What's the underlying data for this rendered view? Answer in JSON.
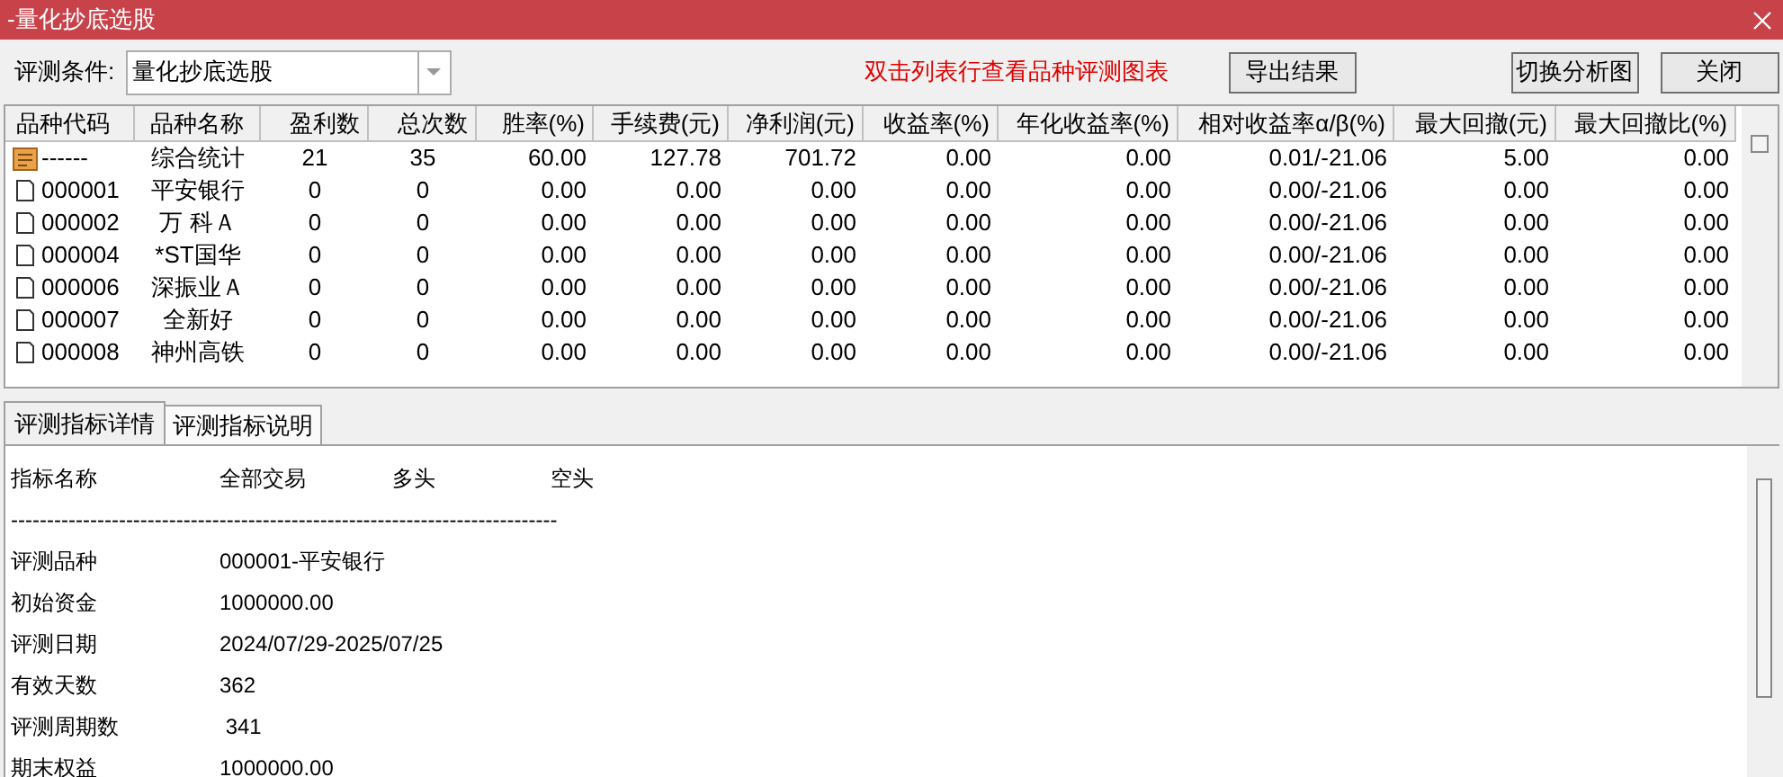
{
  "window": {
    "title": "-量化抄底选股"
  },
  "toolbar": {
    "condition_label": "评测条件:",
    "condition_value": "量化抄底选股",
    "hint": "双击列表行查看品种评测图表",
    "buttons": [
      "导出结果",
      "切换分析图",
      "关闭"
    ]
  },
  "table": {
    "columns": [
      "品种代码",
      "品种名称",
      "盈利数",
      "总次数",
      "胜率(%)",
      "手续费(元)",
      "净利润(元)",
      "收益率(%)",
      "年化收益率(%)",
      "相对收益率α/β(%)",
      "最大回撤(元)",
      "最大回撤比(%)"
    ],
    "rows": [
      {
        "kind": "summary",
        "cells": [
          "------",
          "综合统计",
          "21",
          "35",
          "60.00",
          "127.78",
          "701.72",
          "0.00",
          "0.00",
          "0.01/-21.06",
          "5.00",
          "0.00"
        ]
      },
      {
        "kind": "stock",
        "cells": [
          "000001",
          "平安银行",
          "0",
          "0",
          "0.00",
          "0.00",
          "0.00",
          "0.00",
          "0.00",
          "0.00/-21.06",
          "0.00",
          "0.00"
        ]
      },
      {
        "kind": "stock",
        "cells": [
          "000002",
          "万 科Ａ",
          "0",
          "0",
          "0.00",
          "0.00",
          "0.00",
          "0.00",
          "0.00",
          "0.00/-21.06",
          "0.00",
          "0.00"
        ]
      },
      {
        "kind": "stock",
        "cells": [
          "000004",
          "*ST国华",
          "0",
          "0",
          "0.00",
          "0.00",
          "0.00",
          "0.00",
          "0.00",
          "0.00/-21.06",
          "0.00",
          "0.00"
        ]
      },
      {
        "kind": "stock",
        "cells": [
          "000006",
          "深振业Ａ",
          "0",
          "0",
          "0.00",
          "0.00",
          "0.00",
          "0.00",
          "0.00",
          "0.00/-21.06",
          "0.00",
          "0.00"
        ]
      },
      {
        "kind": "stock",
        "cells": [
          "000007",
          "全新好",
          "0",
          "0",
          "0.00",
          "0.00",
          "0.00",
          "0.00",
          "0.00",
          "0.00/-21.06",
          "0.00",
          "0.00"
        ]
      },
      {
        "kind": "stock",
        "cells": [
          "000008",
          "神州高铁",
          "0",
          "0",
          "0.00",
          "0.00",
          "0.00",
          "0.00",
          "0.00",
          "0.00/-21.06",
          "0.00",
          "0.00"
        ]
      }
    ]
  },
  "tabs": [
    {
      "label": "评测指标详情",
      "selected": true
    },
    {
      "label": "评测指标说明",
      "selected": false
    }
  ],
  "details": {
    "header": [
      "指标名称",
      "全部交易",
      "多头",
      "空头"
    ],
    "separator": "----------------------------------------------------------------------------",
    "rows": [
      {
        "label": "评测品种",
        "value": "000001-平安银行"
      },
      {
        "label": "初始资金",
        "value": "1000000.00"
      },
      {
        "label": "评测日期",
        "value": "2024/07/29-2025/07/25"
      },
      {
        "label": "有效天数",
        "value": "362"
      },
      {
        "label": "评测周期数",
        "value": " 341"
      },
      {
        "label": "期末权益",
        "value": "1000000.00"
      }
    ]
  }
}
